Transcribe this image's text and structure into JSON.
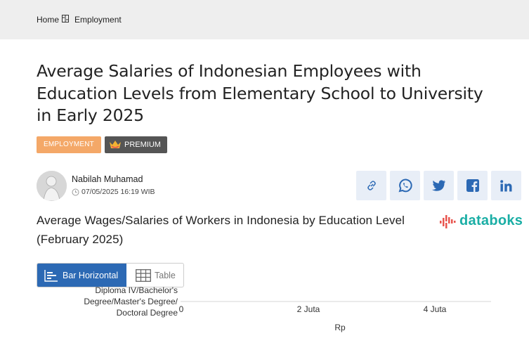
{
  "breadcrumb": {
    "home": "Home",
    "current": "Employment"
  },
  "article": {
    "title": "Average Salaries of Indonesian Employees with Education Levels from Elementary School to University in Early 2025",
    "category": "EMPLOYMENT",
    "premium_label": "PREMIUM",
    "author": "Nabilah Muhamad",
    "date": "07/05/2025 16:19 WIB"
  },
  "share_buttons": [
    "link-icon",
    "whatsapp-icon",
    "twitter-icon",
    "facebook-icon",
    "linkedin-icon"
  ],
  "chart": {
    "title": "Average Wages/Salaries of Workers in Indonesia by Education Level (February 2025)",
    "logo": "databoks",
    "tabs": {
      "bar": "Bar Horizontal",
      "table": "Table"
    }
  },
  "colors": {
    "accent": "#2c69b4",
    "category_badge": "#f4a868",
    "premium_badge": "#555555",
    "logo": "#1aaea5",
    "logo_mark": "#e8544e"
  },
  "chart_data": {
    "type": "bar",
    "orientation": "horizontal",
    "categories_visible": [
      "Diploma IV/Bachelor's Degree/Master's Degree/ Doctoral Degree"
    ],
    "category_label_lines": [
      "Diploma IV/Bachelor's",
      "Degree/Master's Degree/",
      "Doctoral Degree"
    ],
    "xticks": [
      "0",
      "2 Juta",
      "4 Juta"
    ],
    "xlabel": "Rp"
  }
}
